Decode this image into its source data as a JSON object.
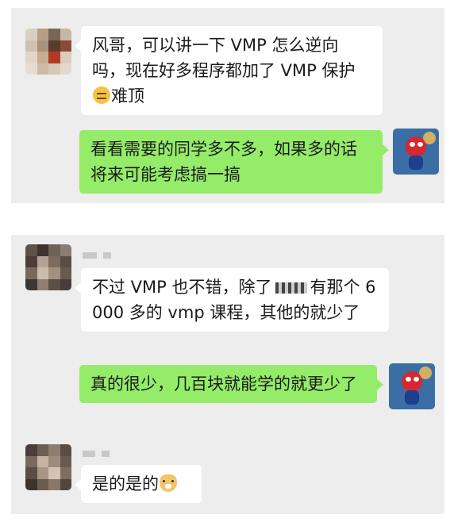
{
  "conversations": [
    {
      "messages": [
        {
          "sender": "other",
          "segments": [
            "风哥，可以讲一下 VMP 怎么逆向吗，现在好多程序都加了 VMP 保护",
            "难顶"
          ],
          "emoji": "thinking-face-emoji"
        },
        {
          "sender": "me",
          "text": "看看需要的同学多不多，如果多的话将来可能考虑搞一搞"
        }
      ]
    },
    {
      "messages": [
        {
          "sender": "other",
          "segments": [
            "不过 VMP 也不错，除了",
            "有那个 6000 多的 vmp 课程，其他的就少了"
          ]
        },
        {
          "sender": "me",
          "text": "真的很少，几百块就能学的就更少了"
        },
        {
          "sender": "other",
          "segments": [
            "是的是的"
          ],
          "emoji": "doge-emoji"
        }
      ]
    }
  ],
  "colors": {
    "panel": "#ededed",
    "incoming_bubble": "#ffffff",
    "outgoing_bubble": "#95ec69",
    "text": "#1a1a1a"
  }
}
